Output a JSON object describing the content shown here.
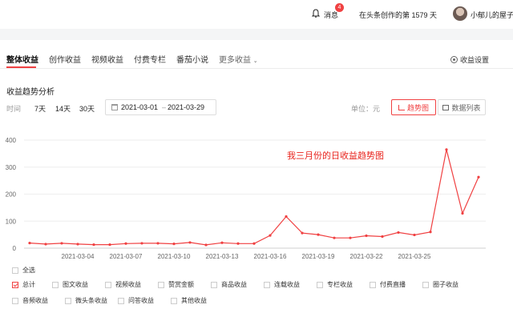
{
  "header": {
    "message_label": "消息",
    "message_badge": "4",
    "creation_days": "在头条创作的第 1579 天",
    "username": "小郁儿的屋子"
  },
  "tabs": [
    {
      "label": "整体收益"
    },
    {
      "label": "创作收益"
    },
    {
      "label": "视频收益"
    },
    {
      "label": "付费专栏"
    },
    {
      "label": "番茄小说"
    },
    {
      "label": "更多收益"
    }
  ],
  "settings_label": "收益设置",
  "section_title": "收益趋势分析",
  "filters": {
    "time_label": "时间",
    "ranges": [
      "7天",
      "14天",
      "30天"
    ],
    "start_date": "2021-03-01",
    "separator": "–",
    "end_date": "2021-03-29",
    "unit_label": "单位：元",
    "trend_button": "趋势图",
    "list_button": "数据列表"
  },
  "annotation": "我三月份的日收益趋势图",
  "colors": {
    "accent": "#f04142",
    "line": "#f04142",
    "annotation": "#e8231c"
  },
  "chart_data": {
    "type": "line",
    "title": "",
    "xlabel": "",
    "ylabel": "",
    "ylim": [
      0,
      400
    ],
    "yticks": [
      0,
      100,
      200,
      300,
      400
    ],
    "grid": true,
    "x": [
      "2021-03-01",
      "2021-03-02",
      "2021-03-03",
      "2021-03-04",
      "2021-03-05",
      "2021-03-06",
      "2021-03-07",
      "2021-03-08",
      "2021-03-09",
      "2021-03-10",
      "2021-03-11",
      "2021-03-12",
      "2021-03-13",
      "2021-03-14",
      "2021-03-15",
      "2021-03-16",
      "2021-03-17",
      "2021-03-18",
      "2021-03-19",
      "2021-03-20",
      "2021-03-21",
      "2021-03-22",
      "2021-03-23",
      "2021-03-24",
      "2021-03-25",
      "2021-03-26",
      "2021-03-27",
      "2021-03-28",
      "2021-03-29"
    ],
    "xtick_labels": [
      "2021-03-04",
      "2021-03-07",
      "2021-03-10",
      "2021-03-13",
      "2021-03-16",
      "2021-03-19",
      "2021-03-22",
      "2021-03-25"
    ],
    "series": [
      {
        "values": [
          19,
          15,
          18,
          15,
          13,
          13,
          17,
          18,
          18,
          16,
          21,
          12,
          20,
          17,
          17,
          47,
          117,
          56,
          50,
          38,
          38,
          46,
          43,
          58,
          49,
          60,
          365,
          129,
          263
        ]
      }
    ]
  },
  "legend": {
    "select_all": "全选",
    "items": [
      {
        "label": "总计",
        "checked": true
      },
      {
        "label": "图文收益",
        "checked": false
      },
      {
        "label": "视频收益",
        "checked": false
      },
      {
        "label": "赞赏金额",
        "checked": false
      },
      {
        "label": "商品收益",
        "checked": false
      },
      {
        "label": "连载收益",
        "checked": false
      },
      {
        "label": "专栏收益",
        "checked": false
      },
      {
        "label": "付费直播",
        "checked": false
      },
      {
        "label": "圈子收益",
        "checked": false
      },
      {
        "label": "音频收益",
        "checked": false
      },
      {
        "label": "微头条收益",
        "checked": false
      },
      {
        "label": "问答收益",
        "checked": false
      },
      {
        "label": "其他收益",
        "checked": false
      }
    ]
  }
}
